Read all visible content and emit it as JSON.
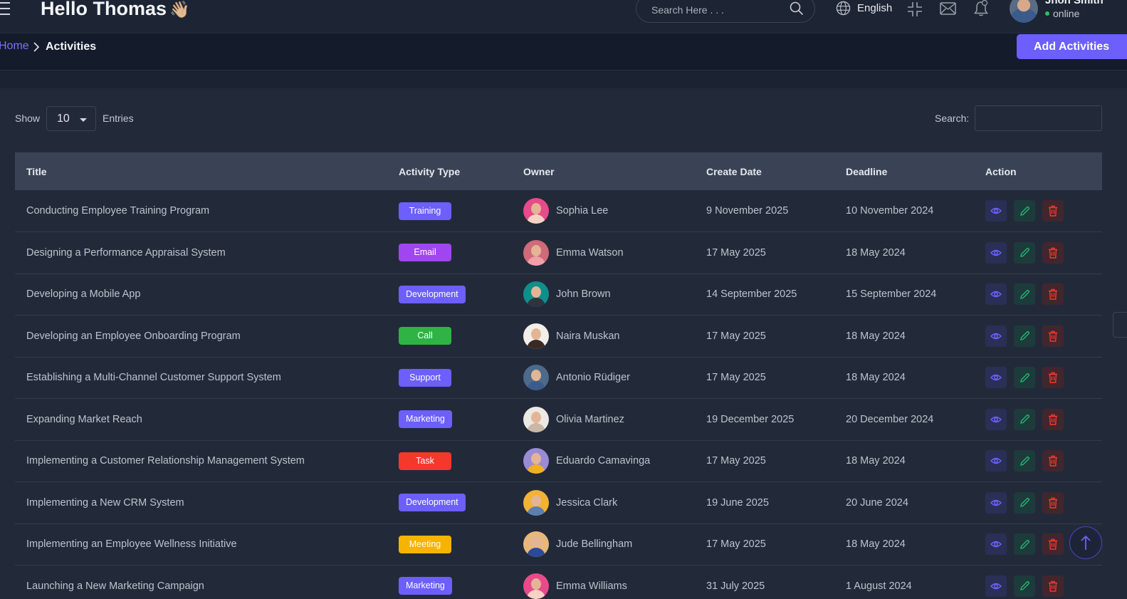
{
  "header": {
    "greeting": "Hello Thomas",
    "wave": "👋🏼",
    "search_placeholder": "Search Here . . .",
    "language": "English",
    "user_name": "Jhon Smith",
    "user_status": "online"
  },
  "breadcrumb": {
    "home": "Home",
    "current": "Activities",
    "add_button": "Add Activities"
  },
  "controls": {
    "show_label": "Show",
    "entries_value": "10",
    "entries_label": "Entries",
    "search_label": "Search:"
  },
  "table": {
    "headers": {
      "title": "Title",
      "type": "Activity Type",
      "owner": "Owner",
      "create": "Create Date",
      "deadline": "Deadline",
      "action": "Action"
    },
    "rows": [
      {
        "title": "Conducting Employee Training Program",
        "type": "Training",
        "type_color": "#6c5ffc",
        "owner": "Sophia Lee",
        "avatar_bg": "#e84a8a",
        "avatar_body": "#f6d2c4",
        "create": "9 November 2025",
        "deadline": "10 November 2024"
      },
      {
        "title": "Designing a Performance Appraisal System",
        "type": "Email",
        "type_color": "#a046f0",
        "owner": "Emma Watson",
        "avatar_bg": "#d06a78",
        "avatar_body": "#f0a0a8",
        "create": "17 May 2025",
        "deadline": "18 May 2024"
      },
      {
        "title": "Developing a Mobile App",
        "type": "Development",
        "type_color": "#6c5ffc",
        "owner": "John Brown",
        "avatar_bg": "#0f8f8a",
        "avatar_body": "#2c3440",
        "create": "14 September 2025",
        "deadline": "15 September 2024"
      },
      {
        "title": "Developing an Employee Onboarding Program",
        "type": "Call",
        "type_color": "#2fb344",
        "owner": "Naira Muskan",
        "avatar_bg": "#f2eeea",
        "avatar_body": "#3a2a24",
        "create": "17 May 2025",
        "deadline": "18 May 2024"
      },
      {
        "title": "Establishing a Multi-Channel Customer Support System",
        "type": "Support",
        "type_color": "#6c5ffc",
        "owner": "Antonio Rüdiger",
        "avatar_bg": "#4d6a8a",
        "avatar_body": "#3b5b8a",
        "create": "17 May 2025",
        "deadline": "18 May 2024"
      },
      {
        "title": "Expanding Market Reach",
        "type": "Marketing",
        "type_color": "#6c5ffc",
        "owner": "Olivia Martinez",
        "avatar_bg": "#ece8e4",
        "avatar_body": "#c9b8a8",
        "create": "19 December 2025",
        "deadline": "20 December 2024"
      },
      {
        "title": "Implementing a Customer Relationship Management System",
        "type": "Task",
        "type_color": "#f5382c",
        "owner": "Eduardo Camavinga",
        "avatar_bg": "#9b8bd6",
        "avatar_body": "#f0b020",
        "create": "17 May 2025",
        "deadline": "18 May 2024"
      },
      {
        "title": "Implementing a New CRM System",
        "type": "Development",
        "type_color": "#6c5ffc",
        "owner": "Jessica Clark",
        "avatar_bg": "#f2b234",
        "avatar_body": "#5a7fb0",
        "create": "19 June 2025",
        "deadline": "20 June 2024"
      },
      {
        "title": "Implementing an Employee Wellness Initiative",
        "type": "Meeting",
        "type_color": "#f5b400",
        "owner": "Jude Bellingham",
        "avatar_bg": "#e8b87a",
        "avatar_body": "#2a4a9a",
        "create": "17 May 2025",
        "deadline": "18 May 2024"
      },
      {
        "title": "Launching a New Marketing Campaign",
        "type": "Marketing",
        "type_color": "#6c5ffc",
        "owner": "Emma Williams",
        "avatar_bg": "#e84a8a",
        "avatar_body": "#f6d2c4",
        "create": "31 July 2025",
        "deadline": "1 August 2024"
      }
    ]
  },
  "colors": {
    "accent": "#6c5ffc",
    "view": "#6c5ffc",
    "edit": "#22b573",
    "delete": "#f5382c"
  },
  "icons": [
    "menu-icon",
    "search-icon",
    "globe-icon",
    "minimize-icon",
    "mail-icon",
    "bell-icon",
    "chevron-right-icon",
    "eye-icon",
    "pencil-icon",
    "trash-icon",
    "arrow-up-icon"
  ]
}
